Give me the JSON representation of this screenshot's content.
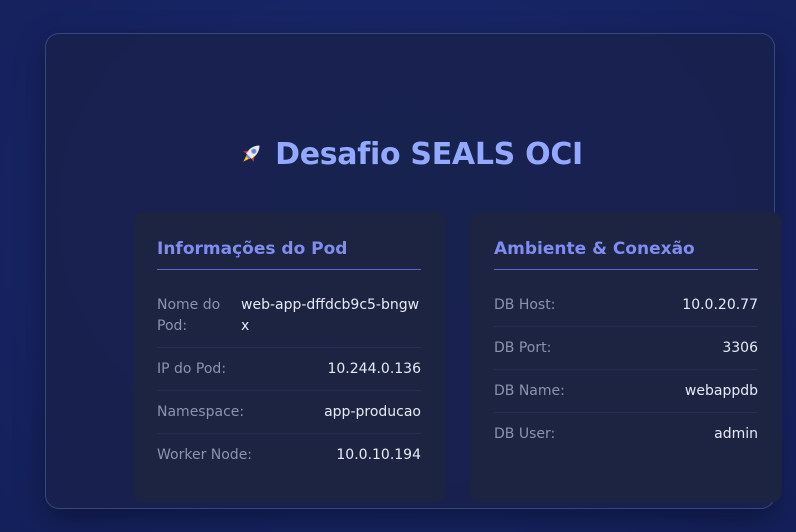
{
  "title": "Desafio SEALS OCI",
  "title_icon": "rocket-icon",
  "pod_card": {
    "title": "Informações do Pod",
    "rows": [
      {
        "label": "Nome do Pod:",
        "value": "web-app-dffdcb9c5-bngwx"
      },
      {
        "label": "IP do Pod:",
        "value": "10.244.0.136"
      },
      {
        "label": "Namespace:",
        "value": "app-producao"
      },
      {
        "label": "Worker Node:",
        "value": "10.0.10.194"
      }
    ]
  },
  "env_card": {
    "title": "Ambiente & Conexão",
    "rows": [
      {
        "label": "DB Host:",
        "value": "10.0.20.77"
      },
      {
        "label": "DB Port:",
        "value": "3306"
      },
      {
        "label": "DB Name:",
        "value": "webappdb"
      },
      {
        "label": "DB User:",
        "value": "admin"
      }
    ]
  },
  "colors": {
    "title": "#93a8ff",
    "card_title": "#7f8cf0",
    "card_bg": "#1c2441",
    "label": "#8b93ad",
    "value": "#e6eaf4"
  }
}
